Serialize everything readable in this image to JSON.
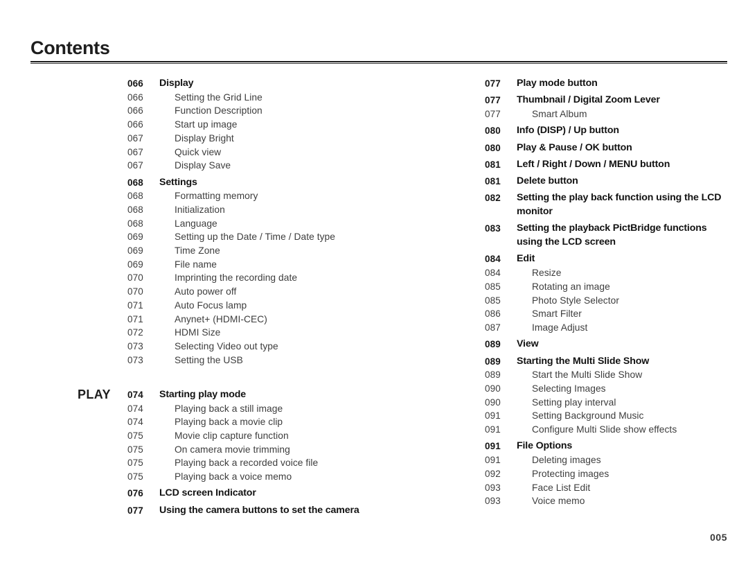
{
  "header": {
    "title": "Contents"
  },
  "footer": {
    "page_number": "005"
  },
  "columns": {
    "left": {
      "mode_tag": "PLAY",
      "entries": [
        {
          "page": "066",
          "label": "Display",
          "level": "heading"
        },
        {
          "page": "066",
          "label": "Setting the Grid Line",
          "level": "sub"
        },
        {
          "page": "066",
          "label": "Function Description",
          "level": "sub"
        },
        {
          "page": "066",
          "label": "Start up image",
          "level": "sub"
        },
        {
          "page": "067",
          "label": "Display Bright",
          "level": "sub"
        },
        {
          "page": "067",
          "label": "Quick view",
          "level": "sub"
        },
        {
          "page": "067",
          "label": "Display Save",
          "level": "sub"
        },
        {
          "page": "068",
          "label": "Settings",
          "level": "heading"
        },
        {
          "page": "068",
          "label": "Formatting memory",
          "level": "sub"
        },
        {
          "page": "068",
          "label": "Initialization",
          "level": "sub"
        },
        {
          "page": "068",
          "label": "Language",
          "level": "sub"
        },
        {
          "page": "069",
          "label": "Setting up the Date / Time / Date type",
          "level": "sub"
        },
        {
          "page": "069",
          "label": "Time Zone",
          "level": "sub"
        },
        {
          "page": "069",
          "label": "File name",
          "level": "sub"
        },
        {
          "page": "070",
          "label": "Imprinting the recording date",
          "level": "sub"
        },
        {
          "page": "070",
          "label": "Auto power off",
          "level": "sub"
        },
        {
          "page": "071",
          "label": "Auto Focus lamp",
          "level": "sub"
        },
        {
          "page": "071",
          "label": "Anynet+ (HDMI-CEC)",
          "level": "sub"
        },
        {
          "page": "072",
          "label": "HDMI Size",
          "level": "sub"
        },
        {
          "page": "073",
          "label": "Selecting Video out type",
          "level": "sub"
        },
        {
          "page": "073",
          "label": "Setting the USB",
          "level": "sub"
        },
        {
          "page": "074",
          "label": "Starting play mode",
          "level": "heading",
          "tag": "PLAY",
          "gap_before": true
        },
        {
          "page": "074",
          "label": "Playing back a still image",
          "level": "sub"
        },
        {
          "page": "074",
          "label": "Playing back a movie clip",
          "level": "sub"
        },
        {
          "page": "075",
          "label": "Movie clip capture function",
          "level": "sub"
        },
        {
          "page": "075",
          "label": "On camera movie trimming",
          "level": "sub"
        },
        {
          "page": "075",
          "label": "Playing back a recorded voice file",
          "level": "sub"
        },
        {
          "page": "075",
          "label": "Playing back a voice memo",
          "level": "sub"
        },
        {
          "page": "076",
          "label": "LCD screen Indicator",
          "level": "heading"
        },
        {
          "page": "077",
          "label": "Using the camera buttons to set the camera",
          "level": "heading"
        }
      ]
    },
    "right": {
      "entries": [
        {
          "page": "077",
          "label": "Play mode button",
          "level": "heading"
        },
        {
          "page": "077",
          "label": "Thumbnail / Digital Zoom  Lever",
          "level": "heading"
        },
        {
          "page": "077",
          "label": "Smart Album",
          "level": "sub"
        },
        {
          "page": "080",
          "label": "Info (DISP) / Up button",
          "level": "heading"
        },
        {
          "page": "080",
          "label": "Play & Pause / OK button",
          "level": "heading"
        },
        {
          "page": "081",
          "label": "Left / Right / Down / MENU button",
          "level": "heading"
        },
        {
          "page": "081",
          "label": "Delete button",
          "level": "heading"
        },
        {
          "page": "082",
          "label": "Setting the play back function using the LCD monitor",
          "level": "heading",
          "wrap": true
        },
        {
          "page": "083",
          "label": "Setting the playback PictBridge functions using the LCD screen",
          "level": "heading",
          "wrap": true
        },
        {
          "page": "084",
          "label": "Edit",
          "level": "heading"
        },
        {
          "page": "084",
          "label": "Resize",
          "level": "sub"
        },
        {
          "page": "085",
          "label": "Rotating an image",
          "level": "sub"
        },
        {
          "page": "085",
          "label": "Photo Style Selector",
          "level": "sub"
        },
        {
          "page": "086",
          "label": "Smart Filter",
          "level": "sub"
        },
        {
          "page": "087",
          "label": "Image Adjust",
          "level": "sub"
        },
        {
          "page": "089",
          "label": "View",
          "level": "heading"
        },
        {
          "page": "089",
          "label": "Starting the Multi Slide Show",
          "level": "heading"
        },
        {
          "page": "089",
          "label": "Start the Multi Slide Show",
          "level": "sub"
        },
        {
          "page": "090",
          "label": "Selecting Images",
          "level": "sub"
        },
        {
          "page": "090",
          "label": "Setting play interval",
          "level": "sub"
        },
        {
          "page": "091",
          "label": "Setting Background Music",
          "level": "sub"
        },
        {
          "page": "091",
          "label": "Configure Multi Slide show effects",
          "level": "sub"
        },
        {
          "page": "091",
          "label": "File Options",
          "level": "heading"
        },
        {
          "page": "091",
          "label": "Deleting images",
          "level": "sub"
        },
        {
          "page": "092",
          "label": "Protecting images",
          "level": "sub"
        },
        {
          "page": "093",
          "label": "Face List Edit",
          "level": "sub"
        },
        {
          "page": "093",
          "label": "Voice memo",
          "level": "sub"
        }
      ]
    }
  }
}
